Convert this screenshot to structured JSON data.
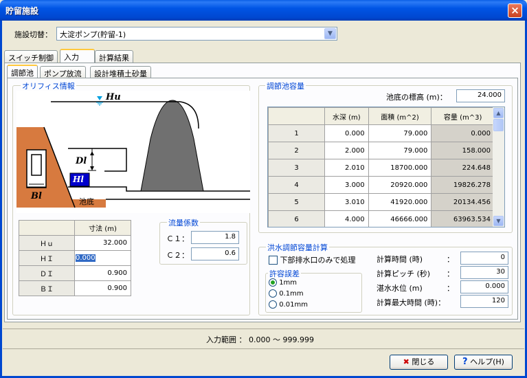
{
  "window": {
    "title": "貯留施設",
    "close_icon": "×"
  },
  "facility": {
    "label": "施設切替：",
    "value": "大淀ポンプ(貯留-1)",
    "drop_icon": "▼"
  },
  "tabs": [
    "スイッチ制御",
    "入力",
    "計算結果"
  ],
  "subtabs": [
    "調節池",
    "ポンプ放流",
    "設計堆積土砂量"
  ],
  "orifice": {
    "title": "オリフィス情報",
    "diagram": {
      "hu": "Hu",
      "dl": "Dl",
      "hl": "Hl",
      "bl": "Bl",
      "bottom": "池底"
    },
    "table": {
      "header": "寸法 (m)",
      "rows": [
        {
          "name": "Ｈｕ",
          "value": "32.000"
        },
        {
          "name": "ＨＩ",
          "value": "0.000"
        },
        {
          "name": "ＤＩ",
          "value": "0.900"
        },
        {
          "name": "ＢＩ",
          "value": "0.900"
        }
      ]
    }
  },
  "flow": {
    "title": "流量係数",
    "c1_label": "Ｃ１：",
    "c1": "1.8",
    "c2_label": "Ｃ２：",
    "c2": "0.6"
  },
  "pond": {
    "title": "調節池容量",
    "elev_label": "池底の標高 (m)：",
    "elev": "24.000",
    "headers": [
      "水深 (m)",
      "面積 (m^2)",
      "容量 (m^3)"
    ],
    "rows": [
      [
        "1",
        "0.000",
        "79.000",
        "0.000"
      ],
      [
        "2",
        "2.000",
        "79.000",
        "158.000"
      ],
      [
        "3",
        "2.010",
        "18700.000",
        "224.648"
      ],
      [
        "4",
        "3.000",
        "20920.000",
        "19826.278"
      ],
      [
        "5",
        "3.010",
        "41920.000",
        "20134.456"
      ],
      [
        "6",
        "4.000",
        "46666.000",
        "63963.534"
      ]
    ],
    "scroll_up": "▲",
    "scroll_down": "▼"
  },
  "flood": {
    "title": "洪水調節容量計算",
    "checkbox_label": "下部排水口のみで処理",
    "tolerance": {
      "title": "許容誤差",
      "options": [
        "1mm",
        "0.1mm",
        "0.01mm"
      ]
    },
    "fields": [
      {
        "label": "計算時間 (時)",
        "colon": "：",
        "value": "0"
      },
      {
        "label": "計算ピッチ (秒)",
        "colon": "：",
        "value": "30"
      },
      {
        "label": "湛水水位 (m)",
        "colon": "：",
        "value": "0.000"
      },
      {
        "label": "計算最大時間 (時)：",
        "colon": "",
        "value": "120"
      }
    ]
  },
  "status": {
    "range": "入力範囲 ： 0.000 〜 999.999"
  },
  "buttons": {
    "close": "閉じる",
    "close_icon": "✖",
    "help": "ヘルプ(H)",
    "help_icon": "?"
  },
  "colors": {
    "title_bar": "#0055E5",
    "earth": "#D77A3F",
    "concrete": "#707070",
    "water_marker": "#00A0E0",
    "label_blue": "#0000CC",
    "group_title": "#0046D5"
  }
}
